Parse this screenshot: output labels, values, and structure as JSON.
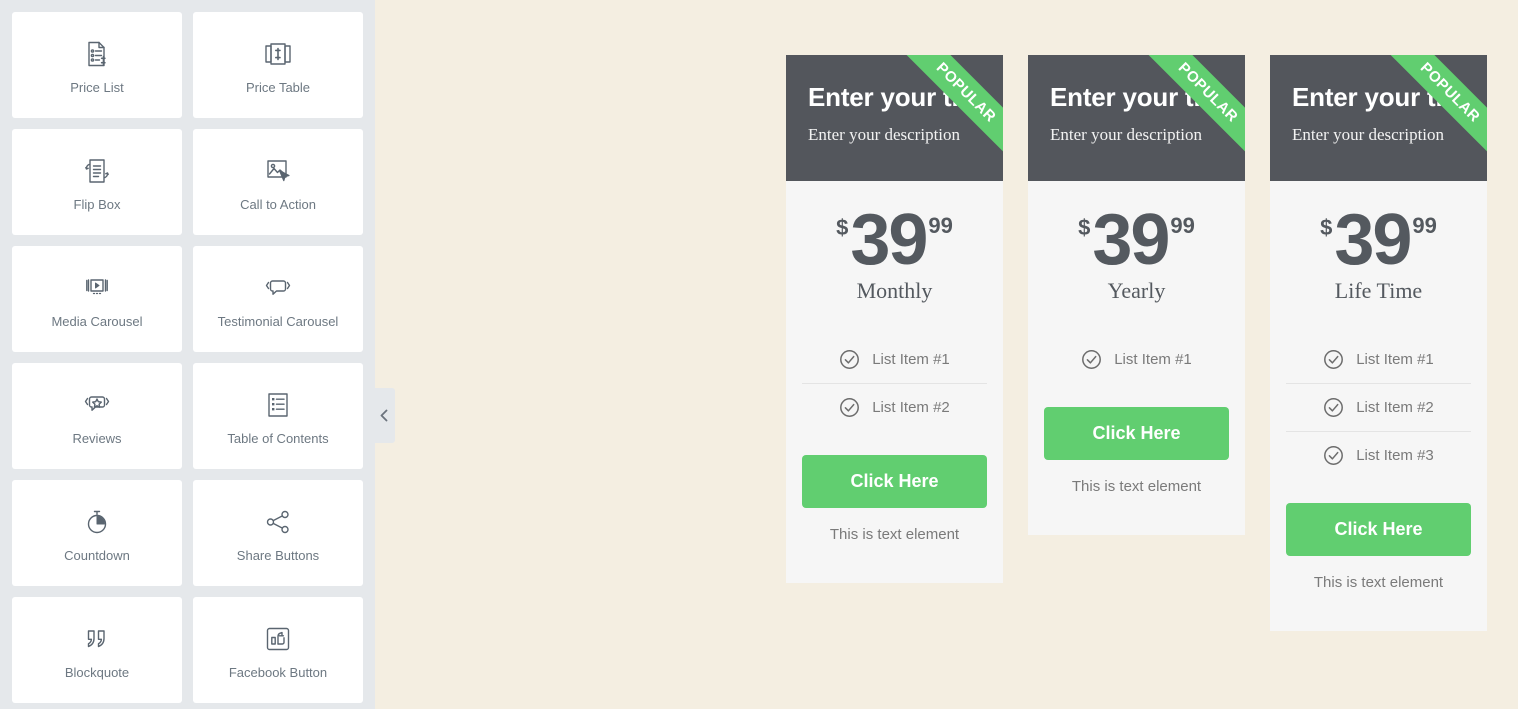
{
  "sidebar": {
    "widgets": [
      {
        "label": "Price List",
        "icon": "price-list-icon"
      },
      {
        "label": "Price Table",
        "icon": "price-table-icon"
      },
      {
        "label": "Flip Box",
        "icon": "flip-box-icon"
      },
      {
        "label": "Call to Action",
        "icon": "call-to-action-icon"
      },
      {
        "label": "Media Carousel",
        "icon": "media-carousel-icon"
      },
      {
        "label": "Testimonial Carousel",
        "icon": "testimonial-carousel-icon"
      },
      {
        "label": "Reviews",
        "icon": "reviews-icon"
      },
      {
        "label": "Table of Contents",
        "icon": "table-of-contents-icon"
      },
      {
        "label": "Countdown",
        "icon": "countdown-icon"
      },
      {
        "label": "Share Buttons",
        "icon": "share-buttons-icon"
      },
      {
        "label": "Blockquote",
        "icon": "blockquote-icon"
      },
      {
        "label": "Facebook Button",
        "icon": "facebook-button-icon"
      }
    ],
    "collapse_handle_icon": "chevron-left-icon"
  },
  "colors": {
    "accent_green": "#61CE70",
    "header_dark": "#53565C",
    "canvas_bg": "#F4EEE1",
    "sidebar_bg": "#E5E8EB",
    "card_bg": "#F6F6F6"
  },
  "canvas": {
    "pricing_cards": [
      {
        "title": "Enter your title",
        "description": "Enter your description",
        "ribbon": "POPULAR",
        "currency": "$",
        "price_integer": "39",
        "price_fraction": "99",
        "period": "Monthly",
        "features": [
          "List Item #1",
          "List Item #2"
        ],
        "cta_label": "Click Here",
        "footer_text": "This is text element"
      },
      {
        "title": "Enter your title",
        "description": "Enter your description",
        "ribbon": "POPULAR",
        "currency": "$",
        "price_integer": "39",
        "price_fraction": "99",
        "period": "Yearly",
        "features": [
          "List Item #1"
        ],
        "cta_label": "Click Here",
        "footer_text": "This is text element"
      },
      {
        "title": "Enter your title",
        "description": "Enter your description",
        "ribbon": "POPULAR",
        "currency": "$",
        "price_integer": "39",
        "price_fraction": "99",
        "period": "Life Time",
        "features": [
          "List Item #1",
          "List Item #2",
          "List Item #3"
        ],
        "cta_label": "Click Here",
        "footer_text": "This is text element"
      }
    ]
  }
}
